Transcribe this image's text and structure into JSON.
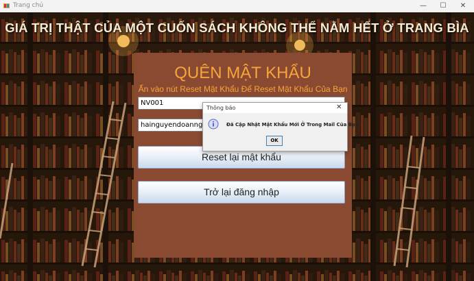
{
  "window": {
    "title": "Trang chủ",
    "minimize": "—",
    "maximize": "☐",
    "close": "✕"
  },
  "headline": "GIÁ TRỊ THẬT CỦA MỘT CUỐN SÁCH KHÔNG THỂ NẰM HẾT Ở TRANG BÌA",
  "panel": {
    "title": "QUÊN MẬT KHẨU",
    "subtitle": "Ấn vào nút Reset Mật Khẩu Để Reset Mật Khẩu Của Bạn",
    "code_value": "NV001",
    "email_value": "hainguyendoanngoc@",
    "reset_label": "Reset lại mật khẩu",
    "back_label": "Trở lại đăng nhập"
  },
  "dialog": {
    "title": "Thông báo",
    "close": "✕",
    "message": "Đã Cập Nhật Mật Khẩu Mới Ở Trong Mail Của Bạn",
    "ok_label": "OK"
  },
  "colors": {
    "panel": "#8a4a32",
    "accent": "#f6a53a",
    "headline": "#f6ecd3"
  },
  "icons": [
    "app-icon",
    "info-icon"
  ]
}
